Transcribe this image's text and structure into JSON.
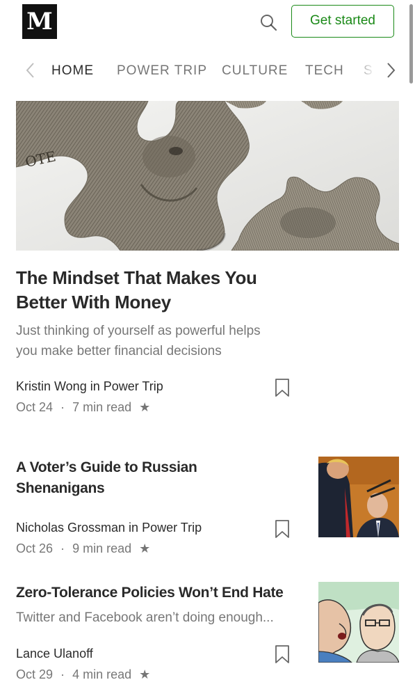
{
  "header": {
    "logo_text": "M",
    "cta_label": "Get started",
    "search_icon": "search-icon"
  },
  "nav": {
    "tabs": [
      {
        "label": "HOME",
        "active": true
      },
      {
        "label": "POWER TRIP",
        "active": false
      },
      {
        "label": "CULTURE",
        "active": false
      },
      {
        "label": "TECH",
        "active": false
      },
      {
        "label": "S",
        "active": false
      }
    ],
    "left_icon": "chevron-left-icon",
    "right_icon": "chevron-right-icon"
  },
  "articles": [
    {
      "title_line1": "The Mindset That Makes You",
      "title_line2": "Better With Money",
      "subtitle_line1": "Just thinking of yourself as powerful helps",
      "subtitle_line2": "you make better financial decisions",
      "author": "Kristin Wong in Power Trip",
      "date": "Oct 24",
      "read_time": "7 min read",
      "image": "puzzle-pieces-dollar-bill-photo"
    },
    {
      "title_line1": "A Voter’s Guide to Russian",
      "title_line2": "Shenanigans",
      "author": "Nicholas Grossman in Power Trip",
      "date": "Oct 26",
      "read_time": "9 min read",
      "image": "two-politicians-photo"
    },
    {
      "title_line1": "Zero-Tolerance Policies Won’t End Hate",
      "subtitle_line1": "Twitter and Facebook aren’t doing enough...",
      "author": "Lance Ulanoff",
      "date": "Oct 29",
      "read_time": "4 min read",
      "image": "two-men-illustration"
    }
  ],
  "meta_separator": "·",
  "star_glyph": "★",
  "colors": {
    "accent_green": "#1a8917",
    "text_primary": "#292929",
    "text_secondary": "#757575"
  }
}
